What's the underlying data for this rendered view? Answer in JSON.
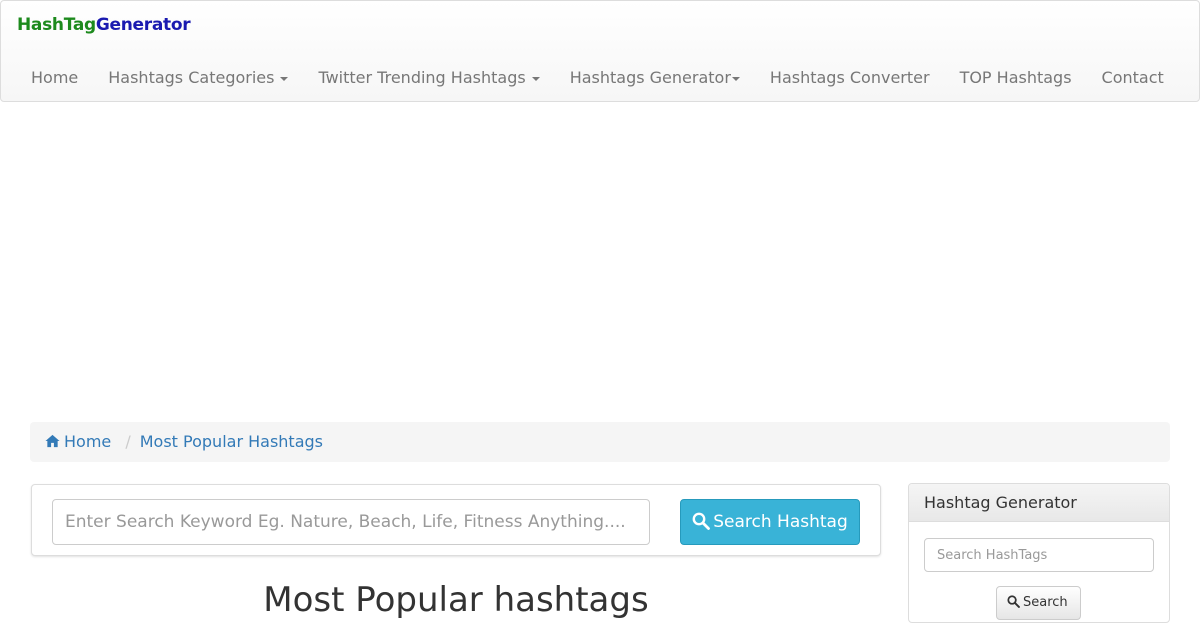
{
  "brand": {
    "part1": "HashTag",
    "part2": "Generator"
  },
  "nav": {
    "items": [
      {
        "label": "Home"
      },
      {
        "label": "Hashtags Categories"
      },
      {
        "label": "Twitter Trending Hashtags"
      },
      {
        "label": "Hashtags Generator"
      },
      {
        "label": "Hashtags Converter"
      },
      {
        "label": "TOP Hashtags"
      },
      {
        "label": "Contact"
      }
    ]
  },
  "breadcrumb": {
    "home": "Home",
    "current": "Most Popular Hashtags"
  },
  "search": {
    "placeholder": "Enter Search Keyword Eg. Nature, Beach, Life, Fitness Anything....",
    "button_label": "Search Hashtag"
  },
  "main": {
    "heading": "Most Popular hashtags"
  },
  "sidebar": {
    "panel_title": "Hashtag Generator",
    "input_placeholder": "Search HashTags",
    "button_label": "Search"
  },
  "colors": {
    "brand_green": "#1d8a1d",
    "brand_blue": "#1a1ab0",
    "link": "#337ab7",
    "info_button": "#39b3d7"
  },
  "icons": {
    "breadcrumb_home": "home-icon",
    "search": "search-icon",
    "dropdown": "caret-down-icon"
  }
}
